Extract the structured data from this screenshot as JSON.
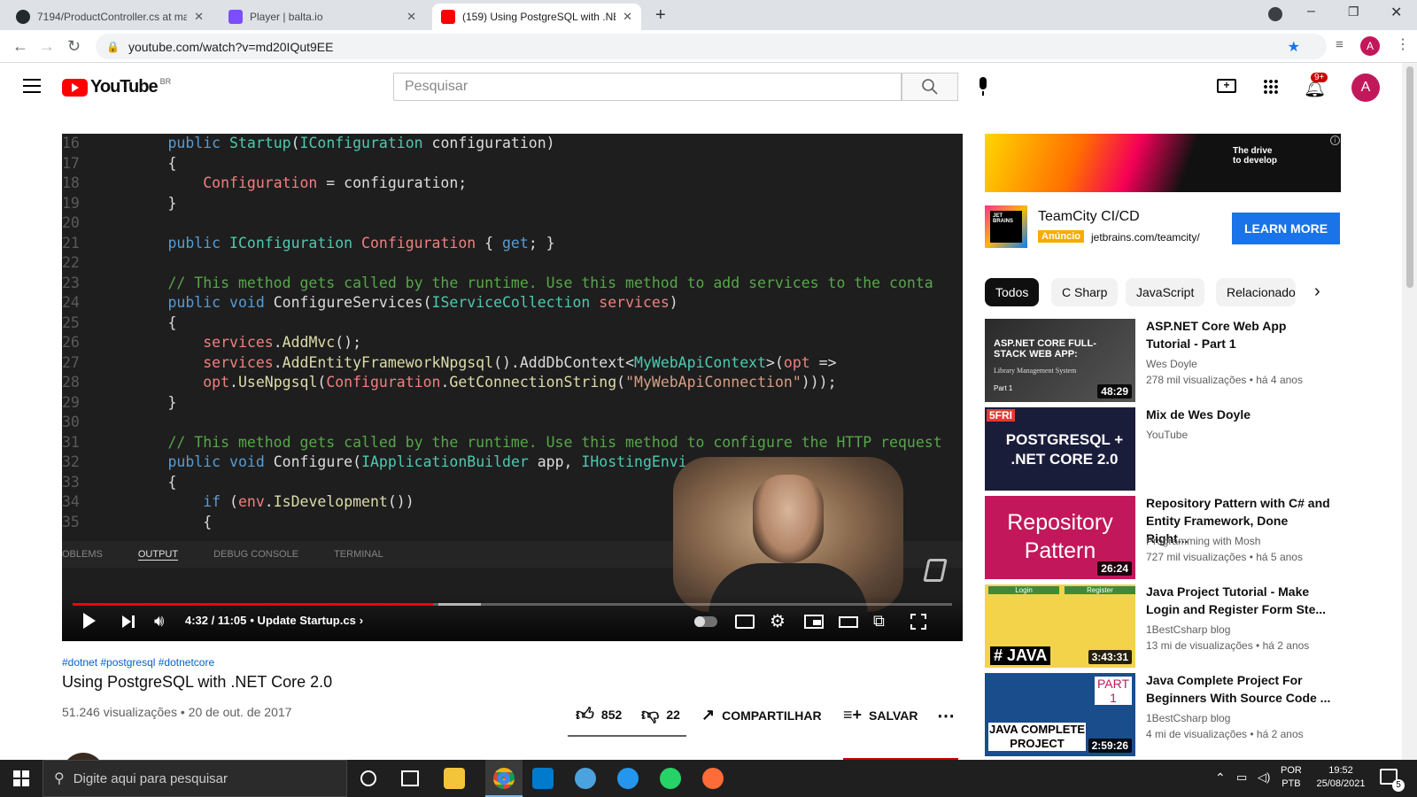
{
  "browser": {
    "tabs": [
      {
        "title": "7194/ProductController.cs at ma"
      },
      {
        "title": "Player | balta.io"
      },
      {
        "title": "(159) Using PostgreSQL with .NET"
      }
    ],
    "url": "youtube.com/watch?v=md20IQut9EE",
    "profile_initial": "A"
  },
  "youtube": {
    "logo": "YouTube",
    "region": "BR",
    "search_placeholder": "Pesquisar",
    "notif_count": "9+",
    "avatar_initial": "A"
  },
  "player": {
    "code_lines": [
      {
        "n": "16",
        "t": "        public Startup(IConfiguration configuration)"
      },
      {
        "n": "17",
        "t": "        {"
      },
      {
        "n": "18",
        "t": "            Configuration = configuration;"
      },
      {
        "n": "19",
        "t": "        }"
      },
      {
        "n": "20",
        "t": ""
      },
      {
        "n": "21",
        "t": "        public IConfiguration Configuration { get; }"
      },
      {
        "n": "22",
        "t": ""
      },
      {
        "n": "23",
        "t": "        // This method gets called by the runtime. Use this method to add services to the conta"
      },
      {
        "n": "24",
        "t": "        public void ConfigureServices(IServiceCollection services)"
      },
      {
        "n": "25",
        "t": "        {"
      },
      {
        "n": "26",
        "t": "            services.AddMvc();"
      },
      {
        "n": "27",
        "t": "            services.AddEntityFrameworkNpgsql().AddDbContext<MyWebApiContext>(opt =>"
      },
      {
        "n": "28",
        "t": "            opt.UseNpgsql(Configuration.GetConnectionString(\"MyWebApiConnection\")));"
      },
      {
        "n": "29",
        "t": "        }"
      },
      {
        "n": "30",
        "t": ""
      },
      {
        "n": "31",
        "t": "        // This method gets called by the runtime. Use this method to configure the HTTP request"
      },
      {
        "n": "32",
        "t": "        public void Configure(IApplicationBuilder app, IHostingEnvi"
      },
      {
        "n": "33",
        "t": "        {"
      },
      {
        "n": "34",
        "t": "            if (env.IsDevelopment())"
      },
      {
        "n": "35",
        "t": "            {"
      }
    ],
    "panel_tabs": [
      "OBLEMS",
      "OUTPUT",
      "DEBUG CONSOLE",
      "TERMINAL"
    ],
    "time": "4:32 / 11:05",
    "chapter": "• Update Startup.cs",
    "chapter_arrow": "›",
    "progress": 0.41
  },
  "video": {
    "hashtags": "#dotnet #postgresql #dotnetcore",
    "title": "Using PostgreSQL with .NET Core 2.0",
    "views": "51.246 visualizações • 20 de out. de 2017",
    "likes": "852",
    "dislikes": "22",
    "share": "COMPARTILHAR",
    "save": "SALVAR"
  },
  "ad": {
    "banner_text": "The drive\nto develop",
    "title": "TeamCity CI/CD",
    "badge": "Anúncio",
    "domain": "jetbrains.com/teamcity/",
    "cta": "LEARN MORE",
    "logo_text": "JET BRAINS"
  },
  "chips": [
    "Todos",
    "C Sharp",
    "JavaScript",
    "Relacionado"
  ],
  "related": [
    {
      "title": "ASP.NET Core Web App Tutorial - Part 1",
      "channel": "Wes Doyle",
      "meta": "278 mil visualizações • há 4 anos",
      "duration": "48:29",
      "thumb_text": "ASP.NET CORE FULL-STACK WEB APP:",
      "thumb_sub": "Library Management System",
      "thumb_part": "Part 1"
    },
    {
      "title": "Mix de Wes Doyle",
      "channel": "YouTube",
      "meta": "",
      "duration": "",
      "thumb_text": "POSTGRESQL + .NET CORE 2.0",
      "thumb_badge": "5FRI"
    },
    {
      "title": "Repository Pattern with C# and Entity Framework, Done Right...",
      "channel": "Programming with Mosh",
      "meta": "727 mil visualizações • há 5 anos",
      "duration": "26:24",
      "thumb_text": "Repository Pattern"
    },
    {
      "title": "Java Project Tutorial - Make Login and Register Form Ste...",
      "channel": "1BestCsharp blog",
      "meta": "13 mi de visualizações • há 2 anos",
      "duration": "3:43:31",
      "thumb_text": "# JAVA",
      "thumb_labels": [
        "Login",
        "Register"
      ]
    },
    {
      "title": "Java Complete Project For Beginners With Source Code ...",
      "channel": "1BestCsharp blog",
      "meta": "4 mi de visualizações • há 2 anos",
      "duration": "2:59:26",
      "thumb_text": "JAVA COMPLETE PROJECT",
      "thumb_part": "PART 1"
    }
  ],
  "taskbar": {
    "search_placeholder": "Digite aqui para pesquisar",
    "lang1": "POR",
    "lang2": "PTB",
    "time": "19:52",
    "date": "25/08/2021",
    "notif": "5"
  },
  "colors": {
    "yt_red": "#ff0000",
    "accent_blue": "#065fd4",
    "ad_button": "#1a73e8"
  }
}
